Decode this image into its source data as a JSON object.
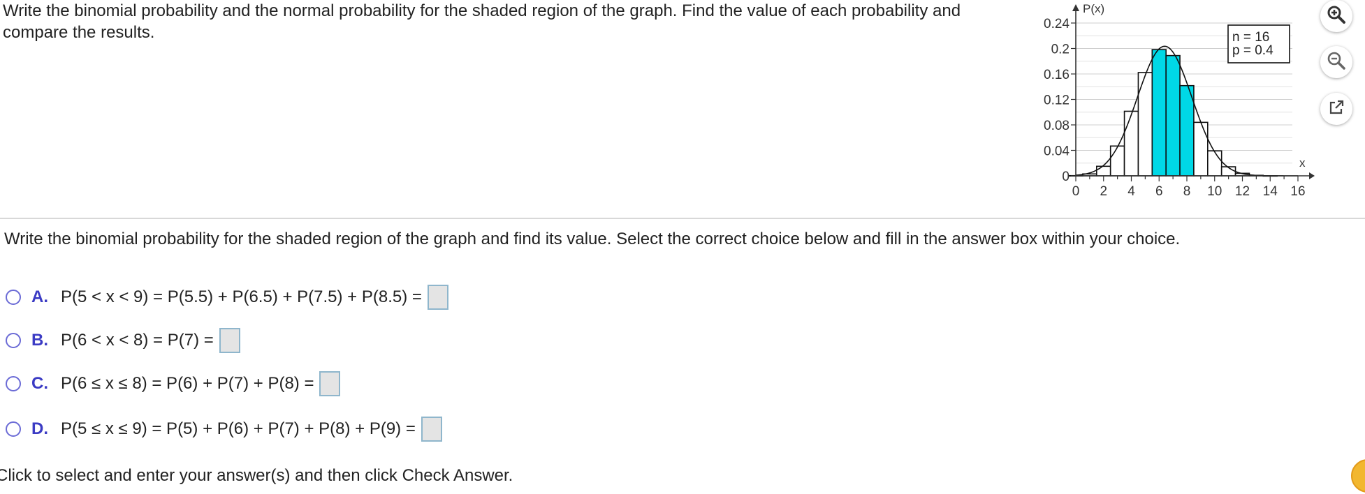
{
  "question": {
    "text": "Write the binomial probability and the normal probability for the shaded region of the graph. Find the value of each probability and compare the results."
  },
  "graph": {
    "y_axis_label": "P(x)",
    "x_axis_label": "x",
    "legend_n": "n = 16",
    "legend_p": "p = 0.4",
    "shade_color": "#00d8e6"
  },
  "chart_data": {
    "type": "bar",
    "title": "",
    "xlabel": "x",
    "ylabel": "P(x)",
    "xlim": [
      0,
      16
    ],
    "ylim": [
      0,
      0.24
    ],
    "x_ticks": [
      0,
      2,
      4,
      6,
      8,
      10,
      12,
      14,
      16
    ],
    "y_ticks": [
      0,
      0.04,
      0.08,
      0.12,
      0.16,
      0.2,
      0.24
    ],
    "x_tick_labels": [
      "0",
      "2",
      "4",
      "6",
      "8",
      "10",
      "12",
      "14",
      "16"
    ],
    "y_tick_labels": [
      "0",
      "0.04",
      "0.08",
      "0.12",
      "0.16",
      "0.2",
      "0.24"
    ],
    "categories": [
      0,
      1,
      2,
      3,
      4,
      5,
      6,
      7,
      8,
      9,
      10,
      11,
      12,
      13,
      14,
      15,
      16
    ],
    "values": [
      0.0003,
      0.003,
      0.015,
      0.0468,
      0.1014,
      0.1623,
      0.1983,
      0.1889,
      0.1417,
      0.084,
      0.0392,
      0.0142,
      0.004,
      0.0008,
      0.0001,
      0.0,
      0.0
    ],
    "shaded_categories": [
      6,
      7,
      8
    ],
    "normal_curve": {
      "mean": 6.4,
      "sd": 1.96
    },
    "grid": true
  },
  "tools": {
    "zoom_in": "zoom-in-icon",
    "zoom_out": "zoom-out-icon",
    "popout": "popout-icon"
  },
  "instruction": "Write the binomial probability for the shaded region of the graph and find its value. Select the correct choice below and fill in the answer box within your choice.",
  "choices": [
    {
      "letter": "A.",
      "text": "P(5 < x < 9) = P(5.5) + P(6.5) + P(7.5) + P(8.5) ="
    },
    {
      "letter": "B.",
      "text": "P(6 < x < 8) = P(7) ="
    },
    {
      "letter": "C.",
      "text": "P(6 ≤ x ≤ 8) = P(6) + P(7) + P(8) ="
    },
    {
      "letter": "D.",
      "text": "P(5 ≤ x ≤ 9) = P(5) + P(6) + P(7) + P(8) + P(9) ="
    }
  ],
  "footer": "Click to select and enter your answer(s) and then click Check Answer."
}
